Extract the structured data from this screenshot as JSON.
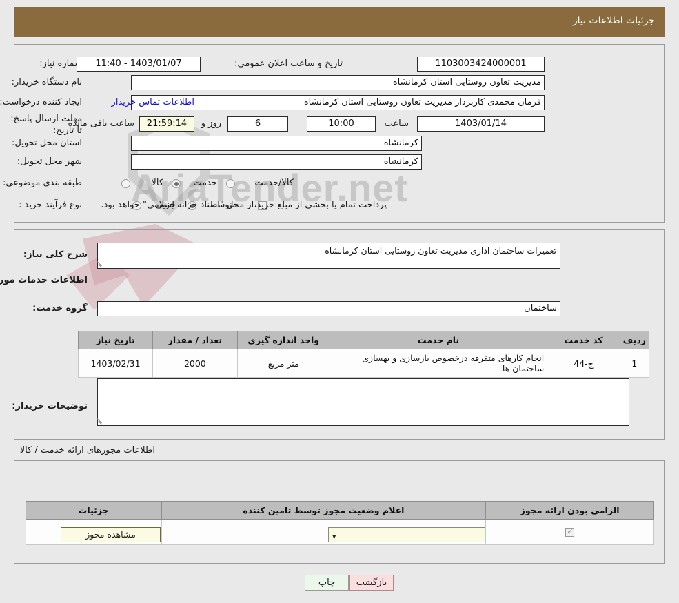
{
  "header": {
    "title": "جزئیات اطلاعات نیاز"
  },
  "summary": {
    "need_number_label": "شماره نیاز:",
    "need_number_value": "1103003424000001",
    "announce_label": "تاریخ و ساعت اعلان عمومی:",
    "announce_value": "1403/01/07 - 11:40",
    "buyer_org_label": "نام دستگاه خریدار:",
    "buyer_org_value": "مدیریت تعاون روستایی استان کرمانشاه",
    "creator_label": "ایجاد کننده درخواست:",
    "creator_value": "فرمان محمدی کاربرداز مدیریت تعاون روستایی استان کرمانشاه",
    "buyer_contact_link": "اطلاعات تماس خریدار",
    "deadline_label": "مهلت ارسال پاسخ: تا تاریخ:",
    "deadline_date": "1403/01/14",
    "deadline_hour_label": "ساعت",
    "deadline_hour": "10:00",
    "remaining_days": "6",
    "days_and_label": "روز و",
    "remaining_time": "21:59:14",
    "remaining_suffix": "ساعت باقی مانده",
    "province_label": "استان محل تحویل:",
    "province_value": "کرمانشاه",
    "city_label": "شهر محل تحویل:",
    "city_value": "کرمانشاه",
    "category_label": "طبقه بندی موضوعی:",
    "category_options": [
      "کالا",
      "خدمت",
      "کالا/خدمت"
    ],
    "category_selected": "خدمت",
    "process_label": "نوع فرآیند خرید :",
    "process_options": [
      "جزیی",
      "متوسط"
    ],
    "process_selected": "متوسط",
    "treasury_checkbox_label": "پرداخت تمام یا بخشی از مبلغ خرید،از محل \"اسناد خزانه اسلامی\" خواهد بود.",
    "treasury_checked": false
  },
  "need_detail": {
    "general_desc_label": "شرح کلی نیاز:",
    "general_desc_value": "تعمیرات ساختمان اداری مدیریت تعاون روستایی استان کرمانشاه",
    "services_info_heading": "اطلاعات خدمات مورد نیاز",
    "service_group_label": "گروه خدمت:",
    "service_group_value": "ساختمان",
    "buyer_notes_label": "توضیحات خریدار:",
    "buyer_notes_value": ""
  },
  "services_table": {
    "columns": [
      "ردیف",
      "کد خدمت",
      "نام خدمت",
      "واحد اندازه گیری",
      "تعداد / مقدار",
      "تاریخ نیاز"
    ],
    "rows": [
      {
        "row_no": "1",
        "service_code": "ج-44",
        "service_name": "انجام کارهای متفرقه درخصوص بازسازی و بهسازی ساختمان ها",
        "unit": "متر مربع",
        "quantity": "2000",
        "need_date": "1403/02/31"
      }
    ]
  },
  "permits": {
    "heading": "اطلاعات مجوزهای ارائه خدمت / کالا",
    "columns": [
      "الزامی بودن ارائه مجوز",
      "اعلام وضعیت مجوز توسط تامین کننده",
      "جزئیات"
    ],
    "rows": [
      {
        "required_checked": true,
        "status_value": "--",
        "details_button": "مشاهده مجوز"
      }
    ]
  },
  "footer": {
    "print_label": "چاپ",
    "back_label": "بازگشت"
  },
  "colors": {
    "header_bar": "#8a6b3d",
    "link": "#1414d2",
    "highlight_field": "#fbfbe4",
    "back_button": "#fbdede",
    "print_button": "#eaf7ea"
  }
}
